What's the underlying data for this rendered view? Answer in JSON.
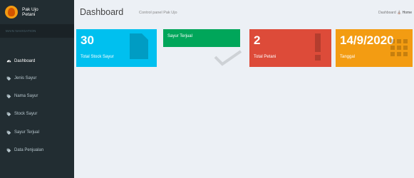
{
  "brand": {
    "line1": "Pak Ujo",
    "line2": "Petani"
  },
  "sidebar": {
    "header": "MAIN NAVIGATION",
    "items": [
      {
        "label": "Dashboard",
        "icon": "dashboard-icon"
      },
      {
        "label": "Jenis Sayur",
        "icon": "tag-icon"
      },
      {
        "label": "Nama Sayur",
        "icon": "tag-icon"
      },
      {
        "label": "Stock Sayur",
        "icon": "tag-icon"
      },
      {
        "label": "Sayur Terjual",
        "icon": "tag-icon"
      },
      {
        "label": "Data Penjualan",
        "icon": "tag-icon"
      }
    ]
  },
  "header": {
    "title": "Dashboard",
    "subtitle": "Control panel Pak Ujo",
    "breadcrumb": {
      "parent": "Dashboard",
      "current": "Home"
    }
  },
  "boxes": [
    {
      "value": "30",
      "label": "Total Stock Sayur",
      "color": "#00c0ef",
      "icon": "file-icon"
    },
    {
      "value": "",
      "label": "Sayur Terjual",
      "color": "#00a65a",
      "icon": "check-icon"
    },
    {
      "value": "2",
      "label": "Total Petani",
      "color": "#dd4b39",
      "icon": "exclamation-icon"
    },
    {
      "value": "14/9/2020",
      "label": "Tanggal",
      "color": "#f39c12",
      "icon": "calendar-icon"
    }
  ]
}
